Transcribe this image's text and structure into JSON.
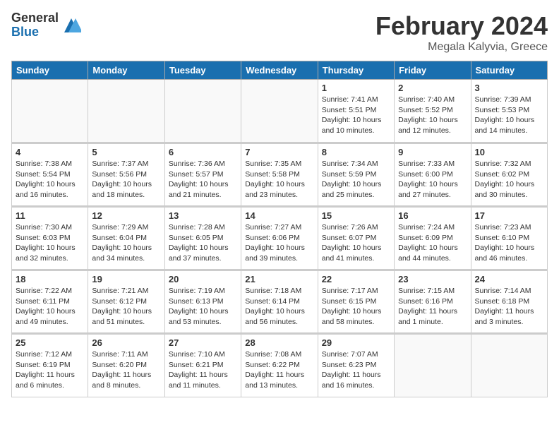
{
  "logo": {
    "general": "General",
    "blue": "Blue"
  },
  "title": "February 2024",
  "location": "Megala Kalyvia, Greece",
  "days_of_week": [
    "Sunday",
    "Monday",
    "Tuesday",
    "Wednesday",
    "Thursday",
    "Friday",
    "Saturday"
  ],
  "weeks": [
    [
      {
        "day": "",
        "info": ""
      },
      {
        "day": "",
        "info": ""
      },
      {
        "day": "",
        "info": ""
      },
      {
        "day": "",
        "info": ""
      },
      {
        "day": "1",
        "info": "Sunrise: 7:41 AM\nSunset: 5:51 PM\nDaylight: 10 hours\nand 10 minutes."
      },
      {
        "day": "2",
        "info": "Sunrise: 7:40 AM\nSunset: 5:52 PM\nDaylight: 10 hours\nand 12 minutes."
      },
      {
        "day": "3",
        "info": "Sunrise: 7:39 AM\nSunset: 5:53 PM\nDaylight: 10 hours\nand 14 minutes."
      }
    ],
    [
      {
        "day": "4",
        "info": "Sunrise: 7:38 AM\nSunset: 5:54 PM\nDaylight: 10 hours\nand 16 minutes."
      },
      {
        "day": "5",
        "info": "Sunrise: 7:37 AM\nSunset: 5:56 PM\nDaylight: 10 hours\nand 18 minutes."
      },
      {
        "day": "6",
        "info": "Sunrise: 7:36 AM\nSunset: 5:57 PM\nDaylight: 10 hours\nand 21 minutes."
      },
      {
        "day": "7",
        "info": "Sunrise: 7:35 AM\nSunset: 5:58 PM\nDaylight: 10 hours\nand 23 minutes."
      },
      {
        "day": "8",
        "info": "Sunrise: 7:34 AM\nSunset: 5:59 PM\nDaylight: 10 hours\nand 25 minutes."
      },
      {
        "day": "9",
        "info": "Sunrise: 7:33 AM\nSunset: 6:00 PM\nDaylight: 10 hours\nand 27 minutes."
      },
      {
        "day": "10",
        "info": "Sunrise: 7:32 AM\nSunset: 6:02 PM\nDaylight: 10 hours\nand 30 minutes."
      }
    ],
    [
      {
        "day": "11",
        "info": "Sunrise: 7:30 AM\nSunset: 6:03 PM\nDaylight: 10 hours\nand 32 minutes."
      },
      {
        "day": "12",
        "info": "Sunrise: 7:29 AM\nSunset: 6:04 PM\nDaylight: 10 hours\nand 34 minutes."
      },
      {
        "day": "13",
        "info": "Sunrise: 7:28 AM\nSunset: 6:05 PM\nDaylight: 10 hours\nand 37 minutes."
      },
      {
        "day": "14",
        "info": "Sunrise: 7:27 AM\nSunset: 6:06 PM\nDaylight: 10 hours\nand 39 minutes."
      },
      {
        "day": "15",
        "info": "Sunrise: 7:26 AM\nSunset: 6:07 PM\nDaylight: 10 hours\nand 41 minutes."
      },
      {
        "day": "16",
        "info": "Sunrise: 7:24 AM\nSunset: 6:09 PM\nDaylight: 10 hours\nand 44 minutes."
      },
      {
        "day": "17",
        "info": "Sunrise: 7:23 AM\nSunset: 6:10 PM\nDaylight: 10 hours\nand 46 minutes."
      }
    ],
    [
      {
        "day": "18",
        "info": "Sunrise: 7:22 AM\nSunset: 6:11 PM\nDaylight: 10 hours\nand 49 minutes."
      },
      {
        "day": "19",
        "info": "Sunrise: 7:21 AM\nSunset: 6:12 PM\nDaylight: 10 hours\nand 51 minutes."
      },
      {
        "day": "20",
        "info": "Sunrise: 7:19 AM\nSunset: 6:13 PM\nDaylight: 10 hours\nand 53 minutes."
      },
      {
        "day": "21",
        "info": "Sunrise: 7:18 AM\nSunset: 6:14 PM\nDaylight: 10 hours\nand 56 minutes."
      },
      {
        "day": "22",
        "info": "Sunrise: 7:17 AM\nSunset: 6:15 PM\nDaylight: 10 hours\nand 58 minutes."
      },
      {
        "day": "23",
        "info": "Sunrise: 7:15 AM\nSunset: 6:16 PM\nDaylight: 11 hours\nand 1 minute."
      },
      {
        "day": "24",
        "info": "Sunrise: 7:14 AM\nSunset: 6:18 PM\nDaylight: 11 hours\nand 3 minutes."
      }
    ],
    [
      {
        "day": "25",
        "info": "Sunrise: 7:12 AM\nSunset: 6:19 PM\nDaylight: 11 hours\nand 6 minutes."
      },
      {
        "day": "26",
        "info": "Sunrise: 7:11 AM\nSunset: 6:20 PM\nDaylight: 11 hours\nand 8 minutes."
      },
      {
        "day": "27",
        "info": "Sunrise: 7:10 AM\nSunset: 6:21 PM\nDaylight: 11 hours\nand 11 minutes."
      },
      {
        "day": "28",
        "info": "Sunrise: 7:08 AM\nSunset: 6:22 PM\nDaylight: 11 hours\nand 13 minutes."
      },
      {
        "day": "29",
        "info": "Sunrise: 7:07 AM\nSunset: 6:23 PM\nDaylight: 11 hours\nand 16 minutes."
      },
      {
        "day": "",
        "info": ""
      },
      {
        "day": "",
        "info": ""
      }
    ]
  ]
}
